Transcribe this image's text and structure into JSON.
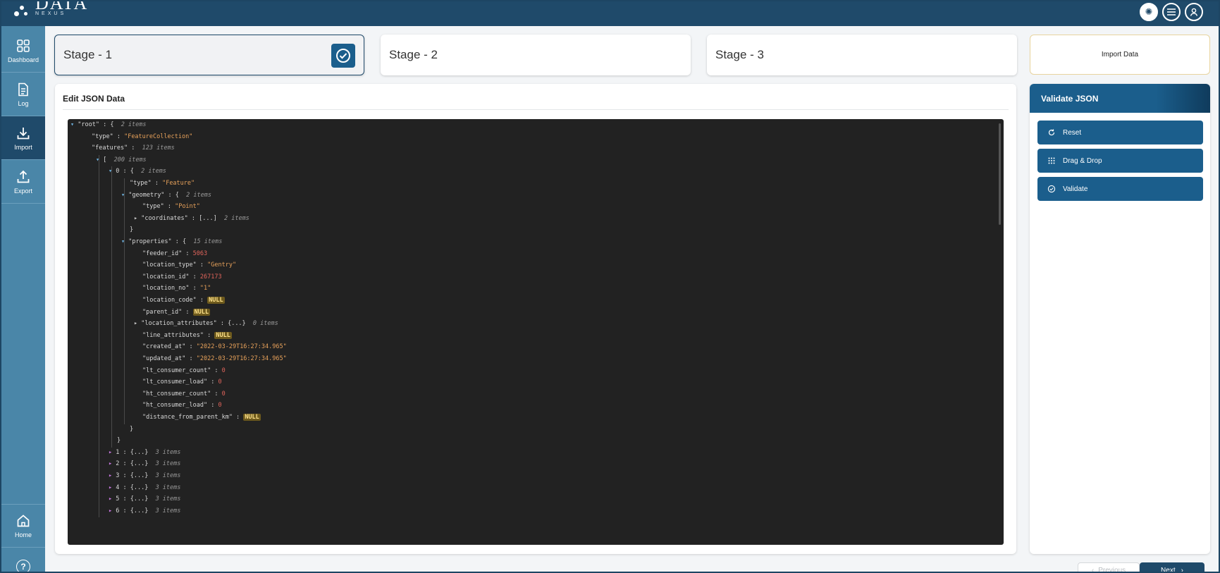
{
  "app": {
    "logo_text": "DATA",
    "logo_sub": "NEXUS"
  },
  "header": {
    "icons": [
      "settings-icon",
      "menu-icon",
      "user-icon"
    ]
  },
  "sidebar": {
    "items": [
      {
        "label": "Dashboard",
        "icon": "dashboard-icon"
      },
      {
        "label": "Log",
        "icon": "log-icon"
      },
      {
        "label": "Import",
        "icon": "import-icon",
        "active": true
      },
      {
        "label": "Export",
        "icon": "export-icon"
      },
      {
        "label": "Home",
        "icon": "home-icon"
      }
    ]
  },
  "stages": [
    {
      "label": "Stage - 1",
      "completed": true
    },
    {
      "label": "Stage - 2"
    },
    {
      "label": "Stage - 3"
    }
  ],
  "import_box": {
    "label": "Import Data"
  },
  "editor": {
    "title": "Edit JSON Data"
  },
  "json_lines": [
    {
      "d": 0,
      "t": "open",
      "k": "\"root\"",
      "b": "{",
      "c": "2 items"
    },
    {
      "d": 1,
      "k": "\"type\"",
      "s": "\"FeatureCollection\""
    },
    {
      "d": 1,
      "k": "\"features\"",
      "c": "123 items"
    },
    {
      "d": 2,
      "t": "open",
      "b": "[",
      "c": "200 items"
    },
    {
      "d": 3,
      "t": "openidx",
      "k": "0",
      "b": "{",
      "c": "2 items"
    },
    {
      "d": 4,
      "k": "\"type\"",
      "s": "\"Feature\""
    },
    {
      "d": 4,
      "t": "open",
      "k": "\"geometry\"",
      "b": "{",
      "c": "2 items"
    },
    {
      "d": 5,
      "k": "\"type\"",
      "s": "\"Point\""
    },
    {
      "d": 5,
      "t": "closed",
      "k": "\"coordinates\"",
      "b": "[...]",
      "c": "2 items"
    },
    {
      "d": 4,
      "close": "}"
    },
    {
      "d": 4,
      "t": "open",
      "k": "\"properties\"",
      "b": "{",
      "c": "15 items"
    },
    {
      "d": 5,
      "k": "\"feeder_id\"",
      "n": "5063"
    },
    {
      "d": 5,
      "k": "\"location_type\"",
      "s": "\"Gentry\""
    },
    {
      "d": 5,
      "k": "\"location_id\"",
      "n": "267173"
    },
    {
      "d": 5,
      "k": "\"location_no\"",
      "s": "\"1\""
    },
    {
      "d": 5,
      "k": "\"location_code\"",
      "z": "NULL"
    },
    {
      "d": 5,
      "k": "\"parent_id\"",
      "z": "NULL"
    },
    {
      "d": 5,
      "t": "closed",
      "k": "\"location_attributes\"",
      "b": "{...}",
      "c": "0 items"
    },
    {
      "d": 5,
      "k": "\"line_attributes\"",
      "z": "NULL"
    },
    {
      "d": 5,
      "k": "\"created_at\"",
      "s": "\"2022-03-29T16:27:34.965\""
    },
    {
      "d": 5,
      "k": "\"updated_at\"",
      "s": "\"2022-03-29T16:27:34.965\""
    },
    {
      "d": 5,
      "k": "\"lt_consumer_count\"",
      "n": "0"
    },
    {
      "d": 5,
      "k": "\"lt_consumer_load\"",
      "n": "0"
    },
    {
      "d": 5,
      "k": "\"ht_consumer_count\"",
      "n": "0"
    },
    {
      "d": 5,
      "k": "\"ht_consumer_load\"",
      "n": "0"
    },
    {
      "d": 5,
      "k": "\"distance_from_parent_km\"",
      "z": "NULL"
    },
    {
      "d": 4,
      "close": "}"
    },
    {
      "d": 3,
      "close": "}"
    },
    {
      "d": 3,
      "t": "closedidx",
      "k": "1",
      "b": "{...}",
      "c": "3 items"
    },
    {
      "d": 3,
      "t": "closedidx",
      "k": "2",
      "b": "{...}",
      "c": "3 items"
    },
    {
      "d": 3,
      "t": "closedidx",
      "k": "3",
      "b": "{...}",
      "c": "3 items"
    },
    {
      "d": 3,
      "t": "closedidx",
      "k": "4",
      "b": "{...}",
      "c": "3 items"
    },
    {
      "d": 3,
      "t": "closedidx",
      "k": "5",
      "b": "{...}",
      "c": "3 items"
    },
    {
      "d": 3,
      "t": "closedidx",
      "k": "6",
      "b": "{...}",
      "c": "3 items"
    }
  ],
  "validate": {
    "title": "Validate JSON",
    "buttons": [
      {
        "label": "Reset",
        "icon": "reset-icon"
      },
      {
        "label": "Drag & Drop",
        "icon": "grid-dots-icon"
      },
      {
        "label": "Validate",
        "icon": "check-circle-icon"
      }
    ]
  },
  "footer": {
    "previous_label": "Previous",
    "next_label": "Next"
  }
}
